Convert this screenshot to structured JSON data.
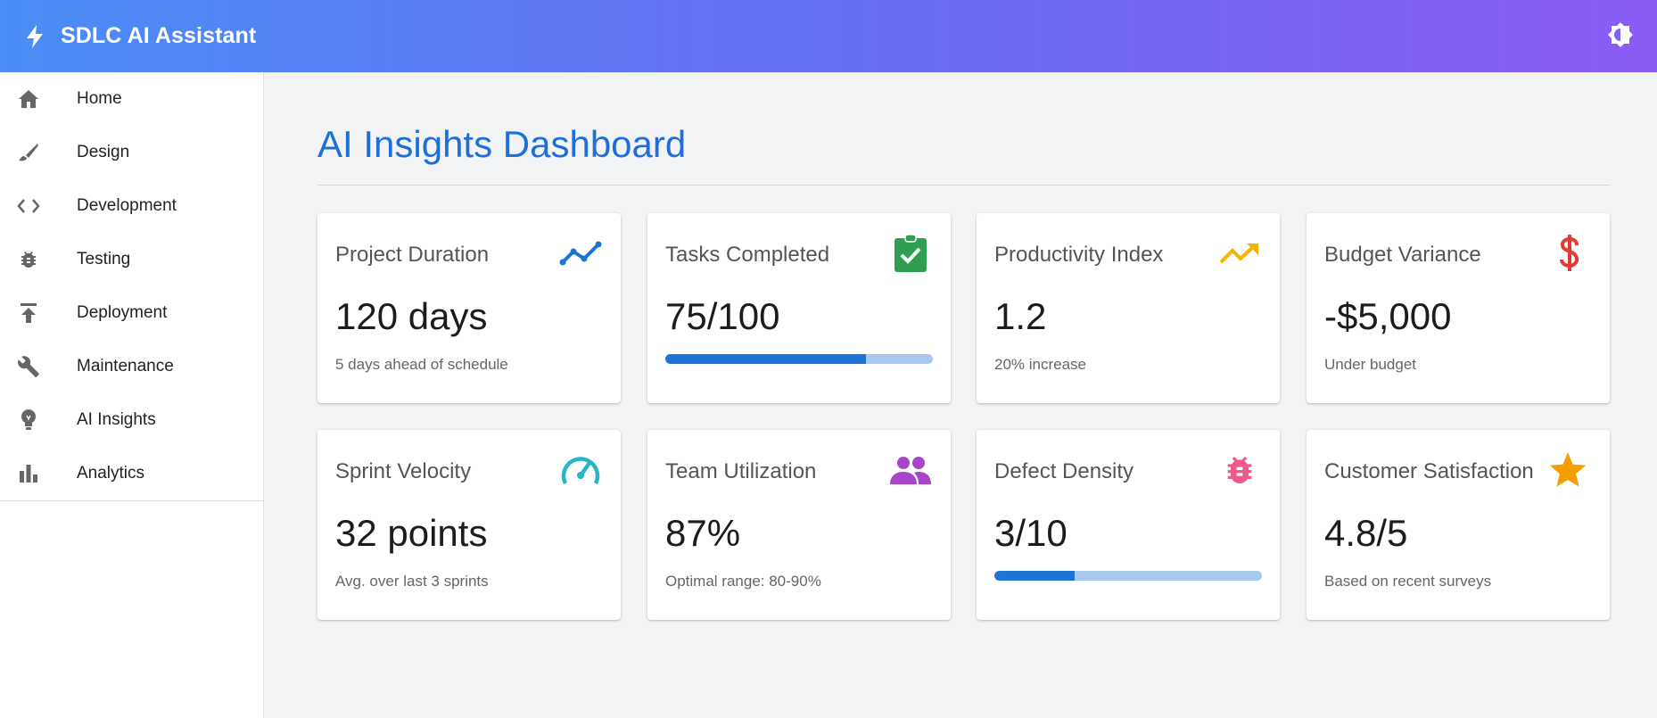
{
  "app": {
    "title": "SDLC AI Assistant"
  },
  "icons": {
    "brand": "bolt-icon",
    "theme_toggle": "brightness-icon"
  },
  "sidebar": {
    "items": [
      {
        "label": "Home",
        "icon": "home-icon"
      },
      {
        "label": "Design",
        "icon": "brush-icon"
      },
      {
        "label": "Development",
        "icon": "code-icon"
      },
      {
        "label": "Testing",
        "icon": "bug-icon"
      },
      {
        "label": "Deployment",
        "icon": "publish-icon"
      },
      {
        "label": "Maintenance",
        "icon": "wrench-icon"
      },
      {
        "label": "AI Insights",
        "icon": "lightbulb-icon"
      },
      {
        "label": "Analytics",
        "icon": "bar-chart-icon"
      }
    ]
  },
  "dashboard": {
    "title": "AI Insights Dashboard",
    "cards": [
      {
        "title": "Project Duration",
        "value": "120 days",
        "subtitle": "5 days ahead of schedule",
        "icon": "timeline-icon",
        "icon_color": "#1e74d2"
      },
      {
        "title": "Tasks Completed",
        "value": "75/100",
        "progress": 0.75,
        "icon": "clipboard-check-icon",
        "icon_color": "#2e9e4f"
      },
      {
        "title": "Productivity Index",
        "value": "1.2",
        "subtitle": "20% increase",
        "icon": "trending-up-icon",
        "icon_color": "#f5b400"
      },
      {
        "title": "Budget Variance",
        "value": "-$5,000",
        "subtitle": "Under budget",
        "icon": "dollar-icon",
        "icon_color": "#e53935"
      },
      {
        "title": "Sprint Velocity",
        "value": "32 points",
        "subtitle": "Avg. over last 3 sprints",
        "icon": "speedometer-icon",
        "icon_color": "#26b5c4"
      },
      {
        "title": "Team Utilization",
        "value": "87%",
        "subtitle": "Optimal range: 80-90%",
        "icon": "people-icon",
        "icon_color": "#a845c8"
      },
      {
        "title": "Defect Density",
        "value": "3/10",
        "progress": 0.3,
        "icon": "bug-icon",
        "icon_color": "#ec5a8e"
      },
      {
        "title": "Customer Satisfaction",
        "value": "4.8/5",
        "subtitle": "Based on recent surveys",
        "icon": "star-icon",
        "icon_color": "#f59e00"
      }
    ]
  }
}
